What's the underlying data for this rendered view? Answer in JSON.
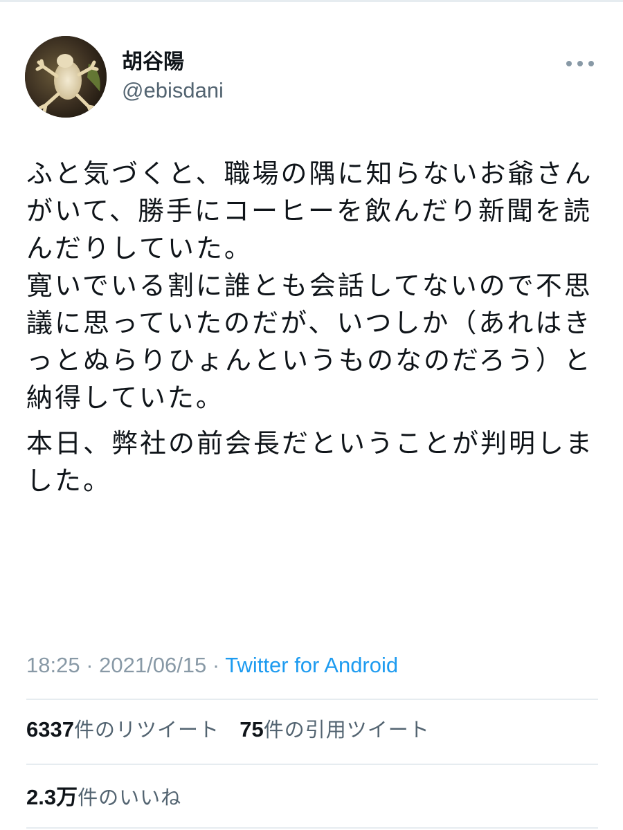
{
  "user": {
    "display_name": "胡谷陽",
    "handle": "@ebisdani",
    "avatar_icon": "frog-photo-avatar"
  },
  "menu": {
    "more_icon": "more-horizontal-icon"
  },
  "tweet": {
    "paragraphs": [
      "ふと気づくと、職場の隅に知らないお爺さんがいて、勝手にコーヒーを飲んだり新聞を読んだりしていた。\n寛いでいる割に誰とも会話してないので不思議に思っていたのだが、いつしか（あれはきっとぬらりひょんというものなのだろう）と納得していた。",
      "本日、弊社の前会長だということが判明しました。"
    ]
  },
  "meta": {
    "time": "18:25",
    "separator": " · ",
    "date": "2021/06/15",
    "source": "Twitter for Android"
  },
  "stats": {
    "retweets": {
      "count": "6337",
      "label": "件のリツイート"
    },
    "quotes": {
      "count": "75",
      "label": "件の引用ツイート"
    },
    "likes": {
      "count": "2.3万",
      "label": "件のいいね"
    }
  },
  "colors": {
    "text": "#0f1419",
    "secondary": "#536471",
    "meta": "#8899a6",
    "link": "#1d9bf0",
    "divider": "#e6ecf0"
  }
}
